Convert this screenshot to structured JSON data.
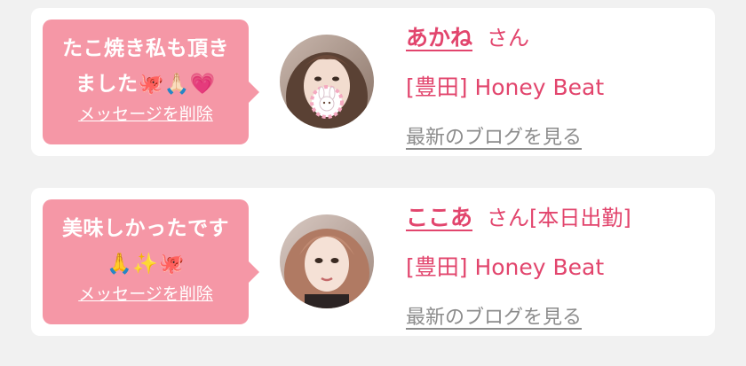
{
  "colors": {
    "background": "#f1f1f1",
    "card": "#ffffff",
    "bubble": "#f597a6",
    "accent": "#e2456d",
    "link_gray": "#8c8c8c"
  },
  "cards": [
    {
      "message": "たこ焼き私も頂き\nました🐙🙏🏻💗",
      "delete_label": "メッセージを削除",
      "avatar_icon": "profile-photo",
      "name": "あかね",
      "suffix": "さん",
      "shop": "[豊田] Honey Beat",
      "blog_link": "最新のブログを見る"
    },
    {
      "message": "美味しかったです\n🙏✨🐙",
      "delete_label": "メッセージを削除",
      "avatar_icon": "profile-photo",
      "name": "ここあ",
      "suffix": "さん[本日出勤]",
      "shop": "[豊田] Honey Beat",
      "blog_link": "最新のブログを見る"
    }
  ]
}
